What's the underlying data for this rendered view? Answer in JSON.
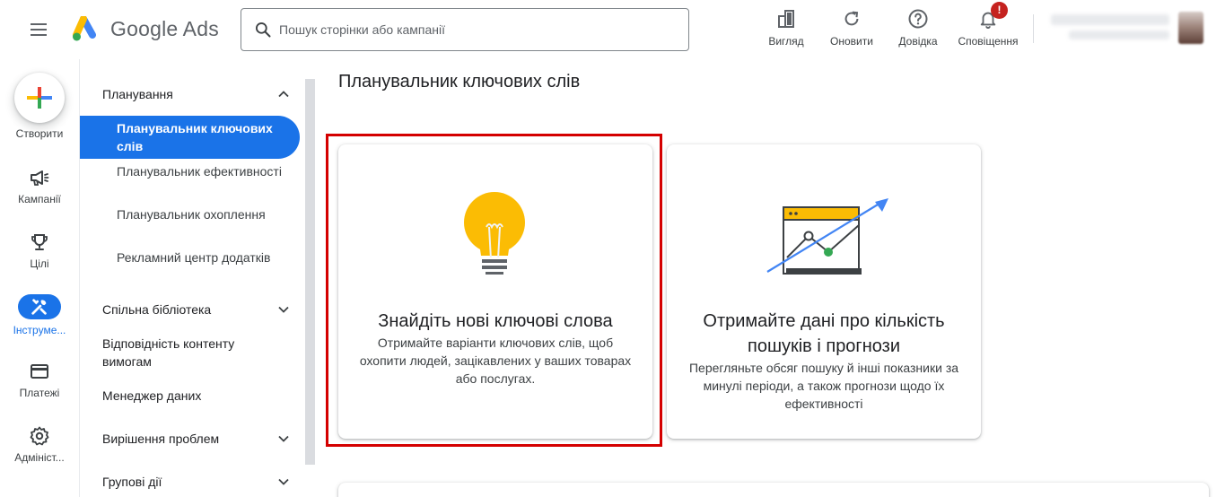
{
  "header": {
    "logo_text": "Google Ads",
    "search_placeholder": "Пошук сторінки або кампанії",
    "actions": [
      {
        "label": "Вигляд",
        "icon": "appearance-icon"
      },
      {
        "label": "Оновити",
        "icon": "refresh-icon"
      },
      {
        "label": "Довідка",
        "icon": "help-icon"
      },
      {
        "label": "Сповіщення",
        "icon": "bell-icon",
        "badge": "!"
      }
    ]
  },
  "rail": {
    "items": [
      {
        "label": "Створити",
        "icon": "plus-icon"
      },
      {
        "label": "Кампанії",
        "icon": "megaphone-icon"
      },
      {
        "label": "Цілі",
        "icon": "trophy-icon"
      },
      {
        "label": "Інструме...",
        "icon": "tools-icon",
        "active": true
      },
      {
        "label": "Платежі",
        "icon": "credit-card-icon"
      },
      {
        "label": "Адмініст...",
        "icon": "gear-icon"
      }
    ]
  },
  "subnav": {
    "planning": {
      "label": "Планування",
      "items": [
        {
          "label": "Планувальник ключових слів",
          "active": true
        },
        {
          "label": "Планувальник ефективності"
        },
        {
          "label": "Планувальник охоплення"
        },
        {
          "label": "Рекламний центр додатків"
        }
      ]
    },
    "shared_library": "Спільна бібліотека",
    "policy_manager": "Відповідність контенту вимогам",
    "data_manager": "Менеджер даних",
    "troubleshooting": "Вирішення проблем",
    "bulk_actions": "Групові дії"
  },
  "main": {
    "title": "Планувальник ключових слів",
    "cards": [
      {
        "title": "Знайдіть нові ключові слова",
        "description": "Отримайте варіанти ключових слів, щоб охопити людей, зацікавлених у ваших товарах або послугах.",
        "icon": "lightbulb-icon",
        "highlighted": true
      },
      {
        "title": "Отримайте дані про кількість пошуків і прогнози",
        "description": "Перегляньте обсяг пошуку й інші показники за минулі періоди, а також прогнози щодо їх ефективності",
        "icon": "trend-chart-icon"
      }
    ]
  },
  "colors": {
    "accent": "#1a73e8",
    "highlight_border": "#d40000",
    "bulb_yellow": "#fbbc04",
    "trend_green": "#34a853",
    "badge_red": "#c5221f"
  }
}
